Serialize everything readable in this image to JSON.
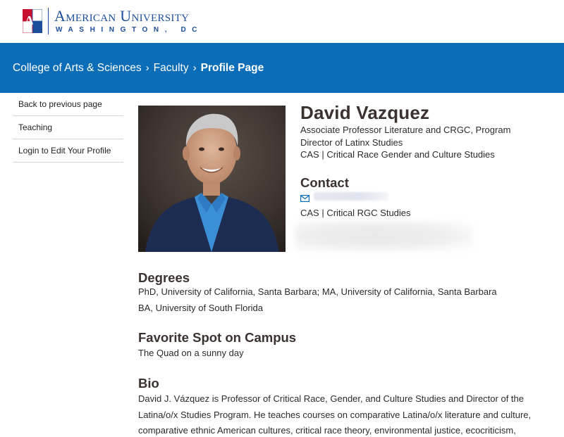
{
  "header": {
    "logo_mark_text": "AU",
    "university_name": "American University",
    "university_location": "WASHINGTON, DC"
  },
  "breadcrumb": {
    "items": [
      "College of Arts & Sciences",
      "Faculty"
    ],
    "separator": "›",
    "current": "Profile Page"
  },
  "side_nav": {
    "items": [
      {
        "label": "Back to previous page"
      },
      {
        "label": "Teaching"
      },
      {
        "label": "Login to Edit Your Profile"
      }
    ]
  },
  "profile": {
    "name": "David Vazquez",
    "title_line_1": "Associate Professor Literature and CRGC, Program Director of Latinx Studies",
    "title_line_2": "CAS | Critical Race Gender and Culture Studies",
    "contact_heading": "Contact",
    "contact_email_icon": "envelope-icon",
    "contact_department": "CAS | Critical RGC Studies"
  },
  "sections": {
    "degrees_heading": "Degrees",
    "degrees_line_1": "PhD, University of California, Santa Barbara; MA, University of California, Santa Barbara",
    "degrees_line_2": "BA, University of South Florida",
    "favorite_heading": "Favorite Spot on Campus",
    "favorite_text": "The Quad on a sunny day",
    "bio_heading": "Bio",
    "bio_text": "David J. Vázquez is Professor of Critical Race, Gender, and Culture Studies and Director of the Latina/o/x Studies Program. He teaches courses on comparative Latina/o/x literature and culture, comparative ethnic American cultures, critical race theory, environmental justice, ecocriticism,"
  },
  "colors": {
    "brand_blue": "#1c4e9c",
    "brand_red": "#c8102e",
    "breadcrumb_bar": "#0b6cb8"
  }
}
